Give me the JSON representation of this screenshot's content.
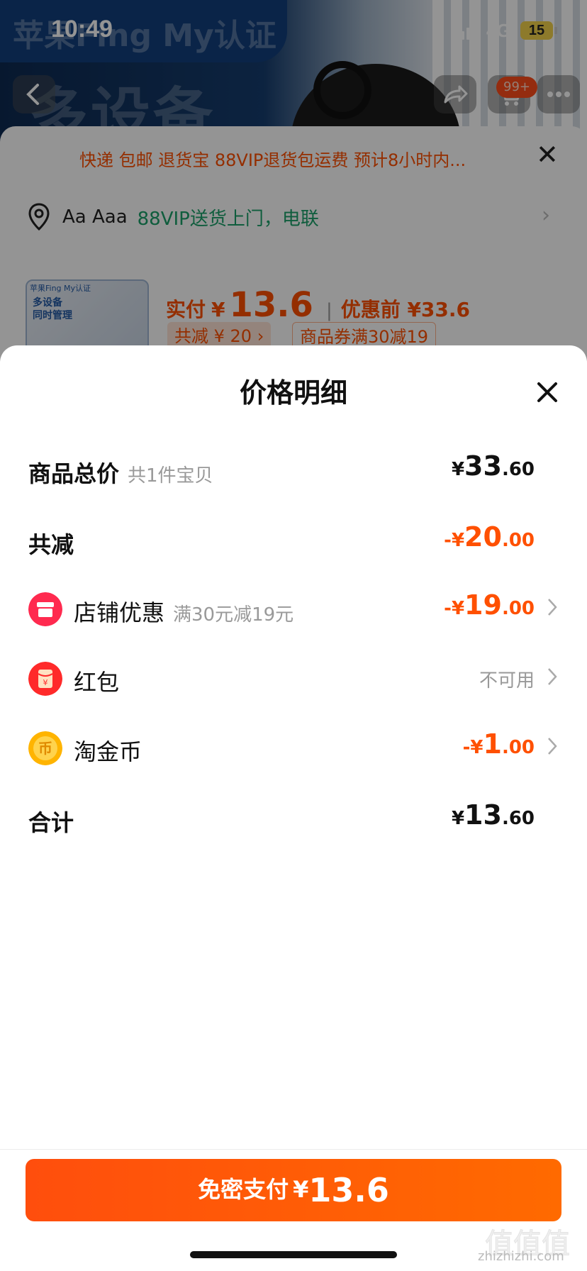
{
  "status_bar": {
    "time": "10:49",
    "network": "4G",
    "battery": "15"
  },
  "background": {
    "banner_text": "苹果Fing My认证",
    "banner_big_text": "多设备",
    "cart_badge": "99+",
    "promo_line": "快递 包邮 退货宝 88VIP退货包运费 预计8小时内...",
    "address_name": "Aa Aaa",
    "address_tag": "88VIP送货上门，电联",
    "product_thumb_label": "苹果Fing My认证",
    "product_thumb_title": "多设备\n同时管理",
    "actual_pay_label": "实付",
    "actual_pay_currency": "¥",
    "actual_pay_value": "13.6",
    "before_discount": "优惠前 ¥33.6",
    "chip_total_discount": "共减 ¥ 20 ›",
    "chip_coupon": "商品券满30减19"
  },
  "sheet": {
    "title": "价格明细",
    "rows": {
      "total": {
        "label": "商品总价",
        "sub": "共1件宝贝",
        "sym": "¥",
        "int": "33",
        "dec": ".60"
      },
      "discount": {
        "label": "共减",
        "sym": "-¥",
        "int": "20",
        "dec": ".00"
      },
      "store": {
        "label": "店铺优惠",
        "sub": "满30元减19元",
        "sym": "-¥",
        "int": "19",
        "dec": ".00",
        "icon": "store-icon"
      },
      "redpacket": {
        "label": "红包",
        "status": "不可用",
        "icon": "red-packet-icon"
      },
      "coins": {
        "label": "淘金币",
        "sym": "-¥",
        "int": "1",
        "dec": ".00",
        "icon": "gold-coin-icon"
      },
      "sum": {
        "label": "合计",
        "sym": "¥",
        "int": "13",
        "dec": ".60"
      }
    },
    "pay_button": {
      "text": "免密支付",
      "currency": "¥",
      "value": "13.6"
    }
  },
  "watermark": {
    "site": "zhizhizhi.com",
    "logo_text": "值值值"
  },
  "colors": {
    "accent": "#ff5000",
    "text": "#111111",
    "muted": "#999999"
  }
}
